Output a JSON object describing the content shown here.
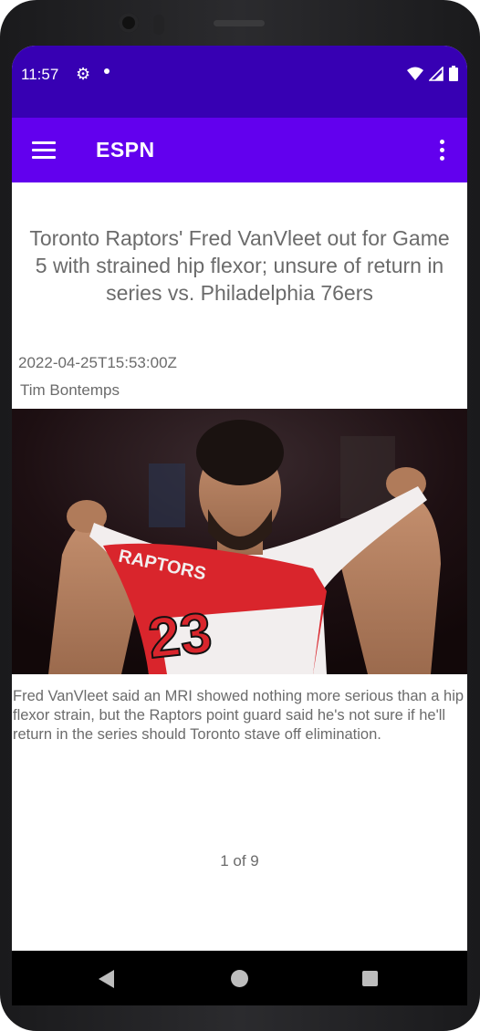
{
  "status_bar": {
    "time": "11:57",
    "icons": [
      "gear-icon",
      "notification-dot-icon",
      "wifi-icon",
      "signal-icon",
      "battery-icon"
    ]
  },
  "app_bar": {
    "title": "ESPN",
    "left_icon": "menu-icon",
    "right_icon": "overflow-menu-icon"
  },
  "article": {
    "title": "Toronto Raptors' Fred VanVleet out for Game 5 with strained hip flexor; unsure of return in series vs. Philadelphia 76ers",
    "date": "2022-04-25T15:53:00Z",
    "author": "Tim Bontemps",
    "image": {
      "jersey_text": "RAPTORS",
      "jersey_number": "23"
    },
    "summary": "Fred VanVleet said an MRI showed nothing more serious than a hip flexor strain, but the Raptors point guard said he's not sure if he'll return in the series should Toronto stave off elimination."
  },
  "pager": {
    "label": "1 of 9"
  },
  "nav_bar": {
    "icons": [
      "back-icon",
      "home-icon",
      "recents-icon"
    ]
  },
  "colors": {
    "status_bar": "#3700b3",
    "app_bar": "#6200ee",
    "text_gray": "#6b6b6b",
    "jersey_red": "#d9252c"
  }
}
